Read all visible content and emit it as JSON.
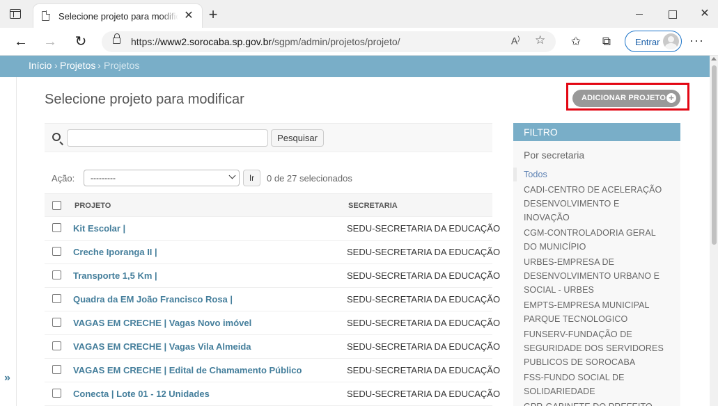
{
  "browser": {
    "tab_title": "Selecione projeto para modificar",
    "tab_close": "✕",
    "new_tab": "+",
    "url_prefix": "https://",
    "url_host": "www2.sorocaba.sp.gov.br",
    "url_path": "/sgpm/admin/projetos/projeto/",
    "read_aloud": "A͈",
    "signin_label": "Entrar",
    "more": "···",
    "window_close": "✕"
  },
  "breadcrumbs": {
    "home": "Início",
    "separator": "›",
    "section": "Projetos",
    "current": "Projetos"
  },
  "page": {
    "title": "Selecione projeto para modificar",
    "add_button": "ADICIONAR PROJETO",
    "add_icon": "+"
  },
  "search": {
    "value": "",
    "button": "Pesquisar"
  },
  "actions": {
    "label": "Ação:",
    "selected_option": "---------",
    "go_button": "Ir",
    "selection_count": "0 de 27 selecionados"
  },
  "table": {
    "columns": [
      "PROJETO",
      "SECRETARIA"
    ],
    "rows": [
      {
        "projeto": "Kit Escolar |",
        "secretaria": "SEDU-SECRETARIA DA EDUCAÇÃO"
      },
      {
        "projeto": "Creche Iporanga II |",
        "secretaria": "SEDU-SECRETARIA DA EDUCAÇÃO"
      },
      {
        "projeto": "Transporte 1,5 Km |",
        "secretaria": "SEDU-SECRETARIA DA EDUCAÇÃO"
      },
      {
        "projeto": "Quadra da EM João Francisco Rosa |",
        "secretaria": "SEDU-SECRETARIA DA EDUCAÇÃO"
      },
      {
        "projeto": "VAGAS EM CRECHE | Vagas Novo imóvel",
        "secretaria": "SEDU-SECRETARIA DA EDUCAÇÃO"
      },
      {
        "projeto": "VAGAS EM CRECHE | Vagas Vila Almeida",
        "secretaria": "SEDU-SECRETARIA DA EDUCAÇÃO"
      },
      {
        "projeto": "VAGAS EM CRECHE | Edital de Chamamento Público",
        "secretaria": "SEDU-SECRETARIA DA EDUCAÇÃO"
      },
      {
        "projeto": "Conecta | Lote 01 - 12 Unidades",
        "secretaria": "SEDU-SECRETARIA DA EDUCAÇÃO"
      }
    ]
  },
  "filter": {
    "title": "FILTRO",
    "subtitle": "Por secretaria",
    "items": [
      "Todos",
      "CADI-CENTRO DE ACELERAÇÃO DESENVOLVIMENTO E INOVAÇÃO",
      "CGM-CONTROLADORIA GERAL DO MUNICÍPIO",
      "URBES-EMPRESA DE DESENVOLVIMENTO URBANO E SOCIAL - URBES",
      "EMPTS-EMPRESA MUNICIPAL PARQUE TECNOLOGICO",
      "FUNSERV-FUNDAÇÃO DE SEGURIDADE DOS SERVIDORES PUBLICOS DE SOROCABA",
      "FSS-FUNDO SOCIAL DE SOLIDARIEDADE",
      "GPR-GABINETE DO PREFEITO"
    ]
  },
  "sidebar_toggle": "»",
  "colors": {
    "header_blue": "#79aec8",
    "link_blue": "#447e9b",
    "highlight_red": "#e30613",
    "add_button_gray": "#999999"
  }
}
